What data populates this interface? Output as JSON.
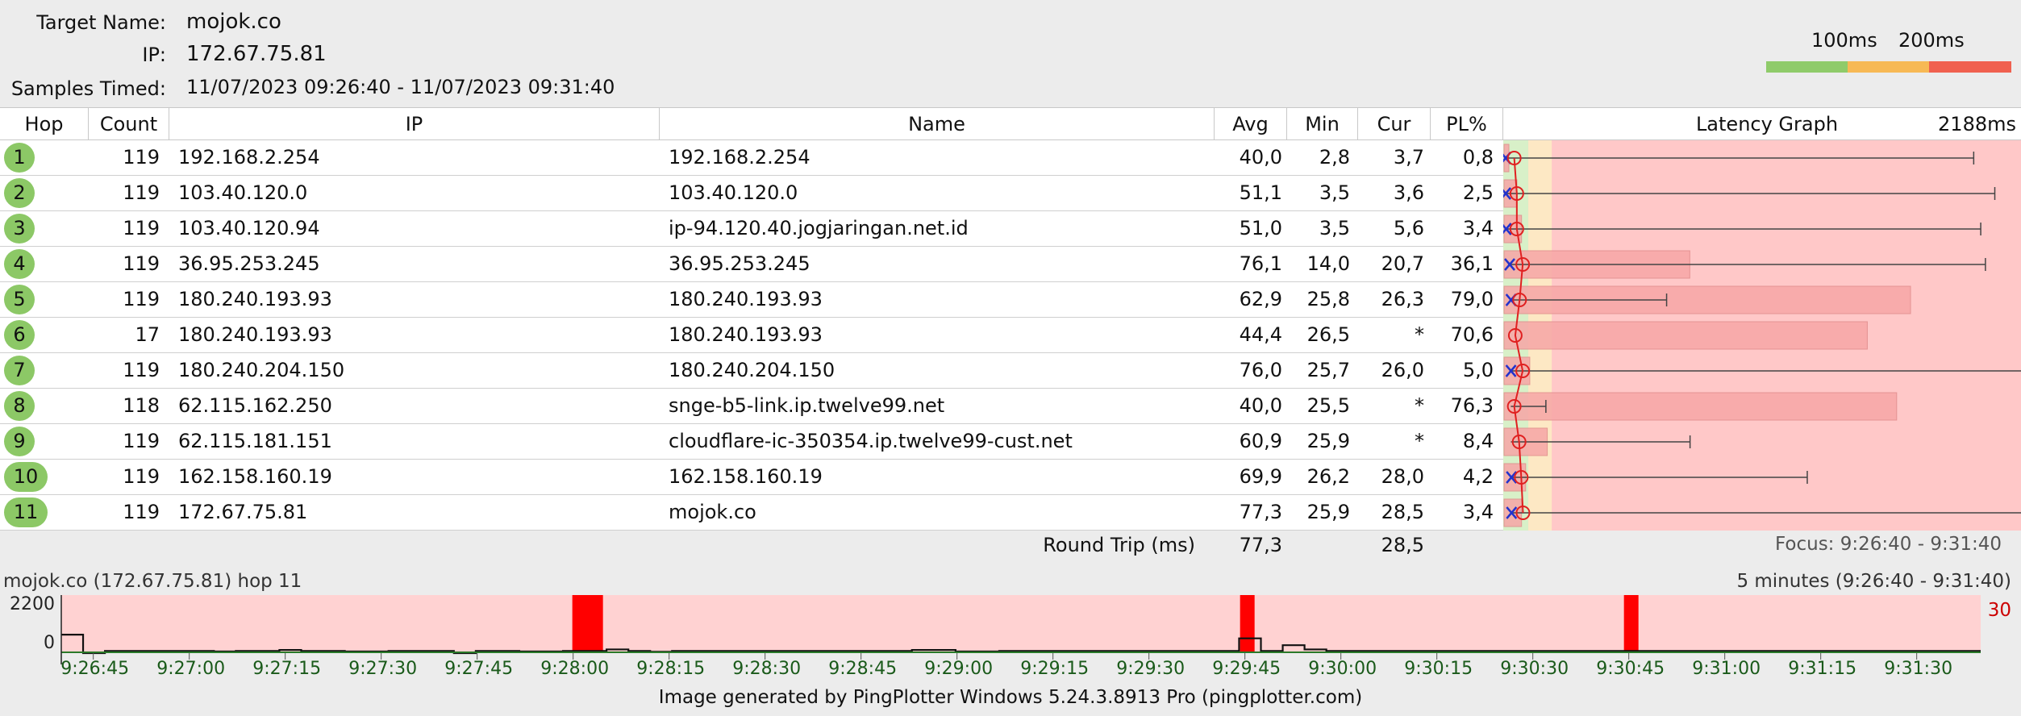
{
  "header": {
    "target_name_label": "Target Name:",
    "target_name": "mojok.co",
    "ip_label": "IP:",
    "ip": "172.67.75.81",
    "samples_label": "Samples Timed:",
    "samples": "11/07/2023 09:26:40 - 11/07/2023 09:31:40",
    "legend_100": "100ms",
    "legend_200": "200ms",
    "colors": {
      "good": "#8fcb6a",
      "warn": "#f7b955",
      "bad": "#f0604f"
    }
  },
  "table": {
    "columns": {
      "hop": "Hop",
      "count": "Count",
      "ip": "IP",
      "name": "Name",
      "avg": "Avg",
      "min": "Min",
      "cur": "Cur",
      "pl": "PL%",
      "graph": "Latency Graph",
      "graph_max": "2188ms"
    },
    "rows": [
      {
        "hop": "1",
        "count": "119",
        "ip": "192.168.2.254",
        "name": "192.168.2.254",
        "avg": "40,0",
        "min": "2,8",
        "cur": "3,7",
        "pl": "0,8"
      },
      {
        "hop": "2",
        "count": "119",
        "ip": "103.40.120.0",
        "name": "103.40.120.0",
        "avg": "51,1",
        "min": "3,5",
        "cur": "3,6",
        "pl": "2,5"
      },
      {
        "hop": "3",
        "count": "119",
        "ip": "103.40.120.94",
        "name": "ip-94.120.40.jogjaringan.net.id",
        "avg": "51,0",
        "min": "3,5",
        "cur": "5,6",
        "pl": "3,4"
      },
      {
        "hop": "4",
        "count": "119",
        "ip": "36.95.253.245",
        "name": "36.95.253.245",
        "avg": "76,1",
        "min": "14,0",
        "cur": "20,7",
        "pl": "36,1"
      },
      {
        "hop": "5",
        "count": "119",
        "ip": "180.240.193.93",
        "name": "180.240.193.93",
        "avg": "62,9",
        "min": "25,8",
        "cur": "26,3",
        "pl": "79,0"
      },
      {
        "hop": "6",
        "count": "17",
        "ip": "180.240.193.93",
        "name": "180.240.193.93",
        "avg": "44,4",
        "min": "26,5",
        "cur": "*",
        "pl": "70,6"
      },
      {
        "hop": "7",
        "count": "119",
        "ip": "180.240.204.150",
        "name": "180.240.204.150",
        "avg": "76,0",
        "min": "25,7",
        "cur": "26,0",
        "pl": "5,0"
      },
      {
        "hop": "8",
        "count": "118",
        "ip": "62.115.162.250",
        "name": "snge-b5-link.ip.twelve99.net",
        "avg": "40,0",
        "min": "25,5",
        "cur": "*",
        "pl": "76,3"
      },
      {
        "hop": "9",
        "count": "119",
        "ip": "62.115.181.151",
        "name": "cloudflare-ic-350354.ip.twelve99-cust.net",
        "avg": "60,9",
        "min": "25,9",
        "cur": "*",
        "pl": "8,4"
      },
      {
        "hop": "10",
        "count": "119",
        "ip": "162.158.160.19",
        "name": "162.158.160.19",
        "avg": "69,9",
        "min": "26,2",
        "cur": "28,0",
        "pl": "4,2"
      },
      {
        "hop": "11",
        "count": "119",
        "ip": "172.67.75.81",
        "name": "mojok.co",
        "avg": "77,3",
        "min": "25,9",
        "cur": "28,5",
        "pl": "3,4"
      }
    ],
    "latency_graph_ms": [
      {
        "hop": "1",
        "avg": 40.0,
        "min": 2.8,
        "cur": 3.7,
        "max": 2000,
        "pl": 0.8
      },
      {
        "hop": "2",
        "avg": 51.1,
        "min": 3.5,
        "cur": 3.6,
        "max": 2090,
        "pl": 2.5
      },
      {
        "hop": "3",
        "avg": 51.0,
        "min": 3.5,
        "cur": 5.6,
        "max": 2030,
        "pl": 3.4
      },
      {
        "hop": "4",
        "avg": 76.1,
        "min": 14.0,
        "cur": 20.7,
        "max": 2050,
        "pl": 36.1
      },
      {
        "hop": "5",
        "avg": 62.9,
        "min": 25.8,
        "cur": 26.3,
        "max": 690,
        "pl": 79.0
      },
      {
        "hop": "6",
        "avg": 44.4,
        "min": 26.5,
        "cur": null,
        "max": null,
        "pl": 70.6
      },
      {
        "hop": "7",
        "avg": 76.0,
        "min": 25.7,
        "cur": 26.0,
        "max": 2270,
        "pl": 5.0
      },
      {
        "hop": "8",
        "avg": 40.0,
        "min": 25.5,
        "cur": null,
        "max": 175,
        "pl": 76.3
      },
      {
        "hop": "9",
        "avg": 60.9,
        "min": 25.9,
        "cur": null,
        "max": 790,
        "pl": 8.4
      },
      {
        "hop": "10",
        "avg": 69.9,
        "min": 26.2,
        "cur": 28.0,
        "max": 1290,
        "pl": 4.2
      },
      {
        "hop": "11",
        "avg": 77.3,
        "min": 25.9,
        "cur": 28.5,
        "max": 2300,
        "pl": 3.4
      }
    ],
    "round_trip": {
      "label": "Round Trip (ms)",
      "avg": "77,3",
      "cur": "28,5",
      "focus": "Focus: 9:26:40 - 9:31:40"
    }
  },
  "history": {
    "title": "mojok.co (172.67.75.81) hop 11",
    "range": "5 minutes (9:26:40 - 9:31:40)",
    "y_top": "2200",
    "y_zero": "0",
    "right_value": "30",
    "time_labels": [
      "9:26:45",
      "9:27:00",
      "9:27:15",
      "9:27:30",
      "9:27:45",
      "9:28:00",
      "9:28:15",
      "9:28:30",
      "9:28:45",
      "9:29:00",
      "9:29:15",
      "9:29:30",
      "9:29:45",
      "9:30:00",
      "9:30:15",
      "9:30:30",
      "9:30:45",
      "9:31:00",
      "9:31:15",
      "9:31:30"
    ],
    "loss_events_time": [
      "9:28:00",
      "9:29:45",
      "9:30:45"
    ],
    "latency_trace_ms": [
      700,
      0,
      80,
      80,
      80,
      80,
      80,
      60,
      80,
      80,
      120,
      80,
      80,
      60,
      60,
      80,
      80,
      80,
      0,
      80,
      80,
      60,
      60,
      80,
      80,
      140,
      80,
      50,
      80,
      80,
      80,
      80,
      80,
      80,
      80,
      80,
      80,
      80,
      80,
      120,
      120,
      60,
      60,
      80,
      80,
      80,
      80,
      80,
      80,
      80,
      80,
      80,
      80,
      80,
      560,
      80,
      300,
      140,
      80,
      80,
      80,
      80,
      80,
      80,
      80,
      80,
      80,
      80,
      80,
      80,
      80,
      80,
      80,
      80,
      80,
      80,
      80,
      80,
      80,
      80,
      80,
      80,
      80,
      80,
      80,
      80,
      80,
      80
    ]
  },
  "footer": "Image generated by PingPlotter Windows 5.24.3.8913 Pro (pingplotter.com)"
}
